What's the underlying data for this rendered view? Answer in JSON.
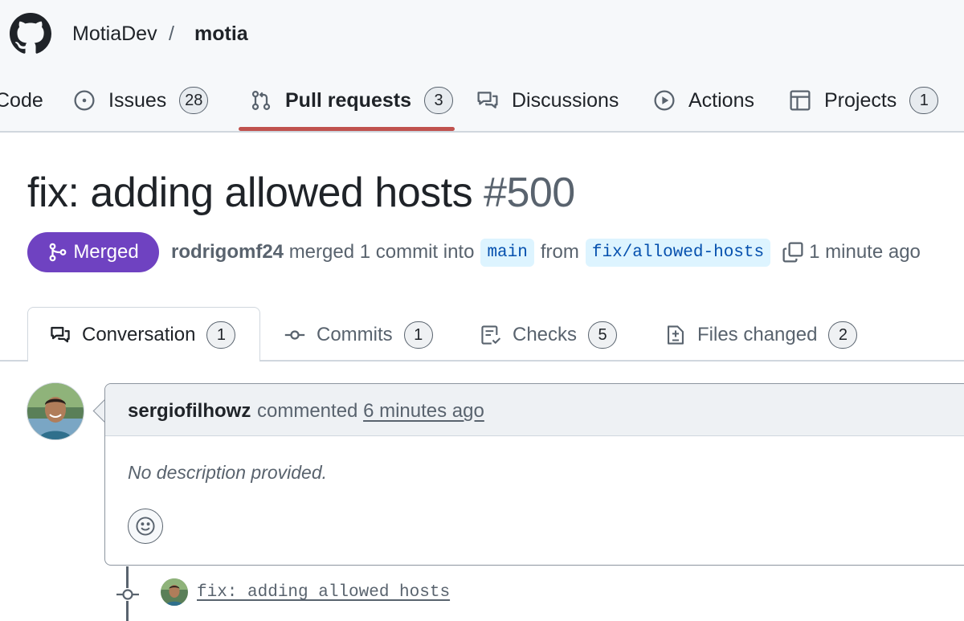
{
  "repo": {
    "owner": "MotiaDev",
    "separator": "/",
    "name": "motia"
  },
  "nav": {
    "tabs": [
      {
        "label": "Code",
        "icon": "code-icon"
      },
      {
        "label": "Issues",
        "count": "28",
        "icon": "issue-opened-icon"
      },
      {
        "label": "Pull requests",
        "count": "3",
        "icon": "git-pull-request-icon",
        "selected": true
      },
      {
        "label": "Discussions",
        "icon": "comment-discussion-icon"
      },
      {
        "label": "Actions",
        "icon": "play-icon"
      },
      {
        "label": "Projects",
        "count": "1",
        "icon": "table-icon"
      }
    ]
  },
  "pr": {
    "title": "fix: adding allowed hosts",
    "number": "#500",
    "state": "Merged",
    "author": "rodrigomf24",
    "action_text": "merged 1 commit into",
    "base_branch": "main",
    "from_text": "from",
    "head_branch": "fix/allowed-hosts",
    "time": "1 minute ago"
  },
  "pr_tabs": [
    {
      "label": "Conversation",
      "count": "1",
      "icon": "comment-discussion-icon",
      "selected": true
    },
    {
      "label": "Commits",
      "count": "1",
      "icon": "git-commit-icon"
    },
    {
      "label": "Checks",
      "count": "5",
      "icon": "checklist-icon"
    },
    {
      "label": "Files changed",
      "count": "2",
      "icon": "file-diff-icon"
    }
  ],
  "comment": {
    "author": "sergiofilhowz",
    "action": "commented",
    "time": "6 minutes ago",
    "body": "No description provided."
  },
  "timeline": {
    "commit_message": "fix: adding allowed hosts"
  },
  "colors": {
    "merged": "#6f42c1",
    "selected_underline": "#c0524e",
    "branch_bg": "#ddf4ff",
    "branch_text": "#0550ae"
  }
}
